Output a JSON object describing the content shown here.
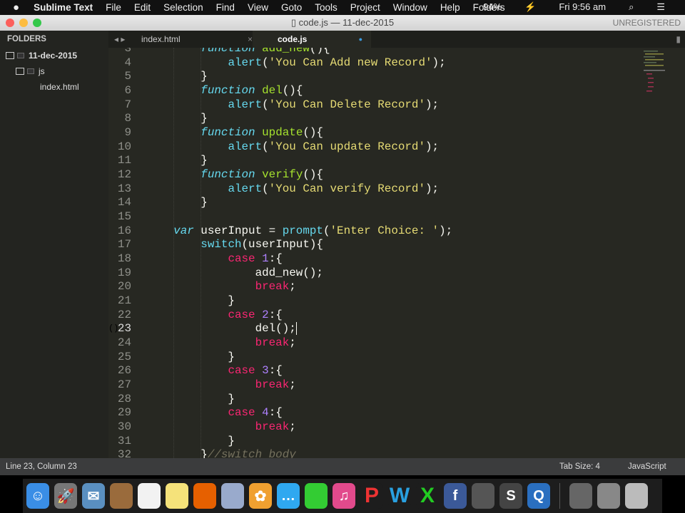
{
  "menubar": {
    "apple": "",
    "app": "Sublime Text",
    "items": [
      "File",
      "Edit",
      "Selection",
      "Find",
      "View",
      "Goto",
      "Tools",
      "Project",
      "Window",
      "Help",
      "Folders"
    ],
    "battery": "94%",
    "clock": "Fri 9:56 am"
  },
  "window": {
    "title": "code.js — 11-dec-2015",
    "unregistered": "UNREGISTERED"
  },
  "sidebar": {
    "header": "FOLDERS",
    "root": "11-dec-2015",
    "subfolder": "js",
    "file": "index.html"
  },
  "tabs": [
    {
      "label": "index.html",
      "close": "×"
    },
    {
      "label": "code.js",
      "modified": "●"
    }
  ],
  "status": {
    "position": "Line 23, Column 23",
    "tab_size": "Tab Size: 4",
    "syntax": "JavaScript"
  },
  "gutter_marker": "()",
  "code": {
    "first_line": 3,
    "lines": [
      [
        [
          "p",
          "        "
        ],
        [
          "fn",
          "function"
        ],
        [
          "p",
          " "
        ],
        [
          "name",
          "add_new"
        ],
        [
          "p",
          "(){"
        ]
      ],
      [
        [
          "p",
          "            "
        ],
        [
          "builtin",
          "alert"
        ],
        [
          "p",
          "("
        ],
        [
          "str",
          "'You Can Add new Record'"
        ],
        [
          "p",
          ");"
        ]
      ],
      [
        [
          "p",
          "        }"
        ]
      ],
      [
        [
          "p",
          "        "
        ],
        [
          "fn",
          "function"
        ],
        [
          "p",
          " "
        ],
        [
          "name",
          "del"
        ],
        [
          "p",
          "(){"
        ]
      ],
      [
        [
          "p",
          "            "
        ],
        [
          "builtin",
          "alert"
        ],
        [
          "p",
          "("
        ],
        [
          "str",
          "'You Can Delete Record'"
        ],
        [
          "p",
          ");"
        ]
      ],
      [
        [
          "p",
          "        }"
        ]
      ],
      [
        [
          "p",
          "        "
        ],
        [
          "fn",
          "function"
        ],
        [
          "p",
          " "
        ],
        [
          "name",
          "update"
        ],
        [
          "p",
          "(){"
        ]
      ],
      [
        [
          "p",
          "            "
        ],
        [
          "builtin",
          "alert"
        ],
        [
          "p",
          "("
        ],
        [
          "str",
          "'You Can update Record'"
        ],
        [
          "p",
          ");"
        ]
      ],
      [
        [
          "p",
          "        }"
        ]
      ],
      [
        [
          "p",
          "        "
        ],
        [
          "fn",
          "function"
        ],
        [
          "p",
          " "
        ],
        [
          "name",
          "verify"
        ],
        [
          "p",
          "(){"
        ]
      ],
      [
        [
          "p",
          "            "
        ],
        [
          "builtin",
          "alert"
        ],
        [
          "p",
          "("
        ],
        [
          "str",
          "'You Can verify Record'"
        ],
        [
          "p",
          ");"
        ]
      ],
      [
        [
          "p",
          "        }"
        ]
      ],
      [
        [
          "p",
          ""
        ]
      ],
      [
        [
          "p",
          "    "
        ],
        [
          "fn",
          "var"
        ],
        [
          "p",
          " userInput = "
        ],
        [
          "builtin",
          "prompt"
        ],
        [
          "p",
          "("
        ],
        [
          "str",
          "'Enter Choice: '"
        ],
        [
          "p",
          ");"
        ]
      ],
      [
        [
          "p",
          "        "
        ],
        [
          "builtin",
          "switch"
        ],
        [
          "p",
          "(userInput){"
        ]
      ],
      [
        [
          "p",
          "            "
        ],
        [
          "kw",
          "case"
        ],
        [
          "p",
          " "
        ],
        [
          "num",
          "1"
        ],
        [
          "p",
          ":{"
        ]
      ],
      [
        [
          "p",
          "                add_new();"
        ]
      ],
      [
        [
          "p",
          "                "
        ],
        [
          "kw",
          "break"
        ],
        [
          "p",
          ";"
        ]
      ],
      [
        [
          "p",
          "            }"
        ]
      ],
      [
        [
          "p",
          "            "
        ],
        [
          "kw",
          "case"
        ],
        [
          "p",
          " "
        ],
        [
          "num",
          "2"
        ],
        [
          "p",
          ":{"
        ]
      ],
      [
        [
          "p",
          "                del();"
        ]
      ],
      [
        [
          "p",
          "                "
        ],
        [
          "kw",
          "break"
        ],
        [
          "p",
          ";"
        ]
      ],
      [
        [
          "p",
          "            }"
        ]
      ],
      [
        [
          "p",
          "            "
        ],
        [
          "kw",
          "case"
        ],
        [
          "p",
          " "
        ],
        [
          "num",
          "3"
        ],
        [
          "p",
          ":{"
        ]
      ],
      [
        [
          "p",
          "                "
        ],
        [
          "kw",
          "break"
        ],
        [
          "p",
          ";"
        ]
      ],
      [
        [
          "p",
          "            }"
        ]
      ],
      [
        [
          "p",
          "            "
        ],
        [
          "kw",
          "case"
        ],
        [
          "p",
          " "
        ],
        [
          "num",
          "4"
        ],
        [
          "p",
          ":{"
        ]
      ],
      [
        [
          "p",
          "                "
        ],
        [
          "kw",
          "break"
        ],
        [
          "p",
          ";"
        ]
      ],
      [
        [
          "p",
          "            }"
        ]
      ],
      [
        [
          "p",
          "        }"
        ],
        [
          "cmt",
          "//switch body"
        ]
      ]
    ]
  },
  "dock": [
    {
      "name": "finder",
      "color": "#3a8ee6",
      "glyph": "☺"
    },
    {
      "name": "launchpad",
      "color": "#777",
      "glyph": "🚀"
    },
    {
      "name": "mail",
      "color": "#5a8fc0",
      "glyph": "✉"
    },
    {
      "name": "contacts",
      "color": "#9a6b3c",
      "glyph": ""
    },
    {
      "name": "reminders",
      "color": "#f2f2f2",
      "glyph": ""
    },
    {
      "name": "notes",
      "color": "#f5e27a",
      "glyph": ""
    },
    {
      "name": "firefox",
      "color": "#e66000",
      "glyph": ""
    },
    {
      "name": "preview",
      "color": "#9ac",
      "glyph": ""
    },
    {
      "name": "photos",
      "color": "#f0a030",
      "glyph": "✿"
    },
    {
      "name": "messages",
      "color": "#2fa8f0",
      "glyph": "…"
    },
    {
      "name": "facetime",
      "color": "#3c3",
      "glyph": ""
    },
    {
      "name": "itunes",
      "color": "#e24a8c",
      "glyph": "♫"
    },
    {
      "name": "powerpoint",
      "color": "#1d1d1d",
      "glyph": "P"
    },
    {
      "name": "word",
      "color": "#1d1d1d",
      "glyph": "W"
    },
    {
      "name": "excel",
      "color": "#1d1d1d",
      "glyph": "X"
    },
    {
      "name": "facebook",
      "color": "#3b5998",
      "glyph": "f"
    },
    {
      "name": "photo-app",
      "color": "#555",
      "glyph": ""
    },
    {
      "name": "sublime-text",
      "color": "#444",
      "glyph": "S"
    },
    {
      "name": "quicktime",
      "color": "#2a6fc0",
      "glyph": "Q"
    },
    {
      "name": "stack-1",
      "color": "#666",
      "glyph": ""
    },
    {
      "name": "stack-2",
      "color": "#888",
      "glyph": ""
    },
    {
      "name": "trash",
      "color": "#bbb",
      "glyph": ""
    }
  ]
}
